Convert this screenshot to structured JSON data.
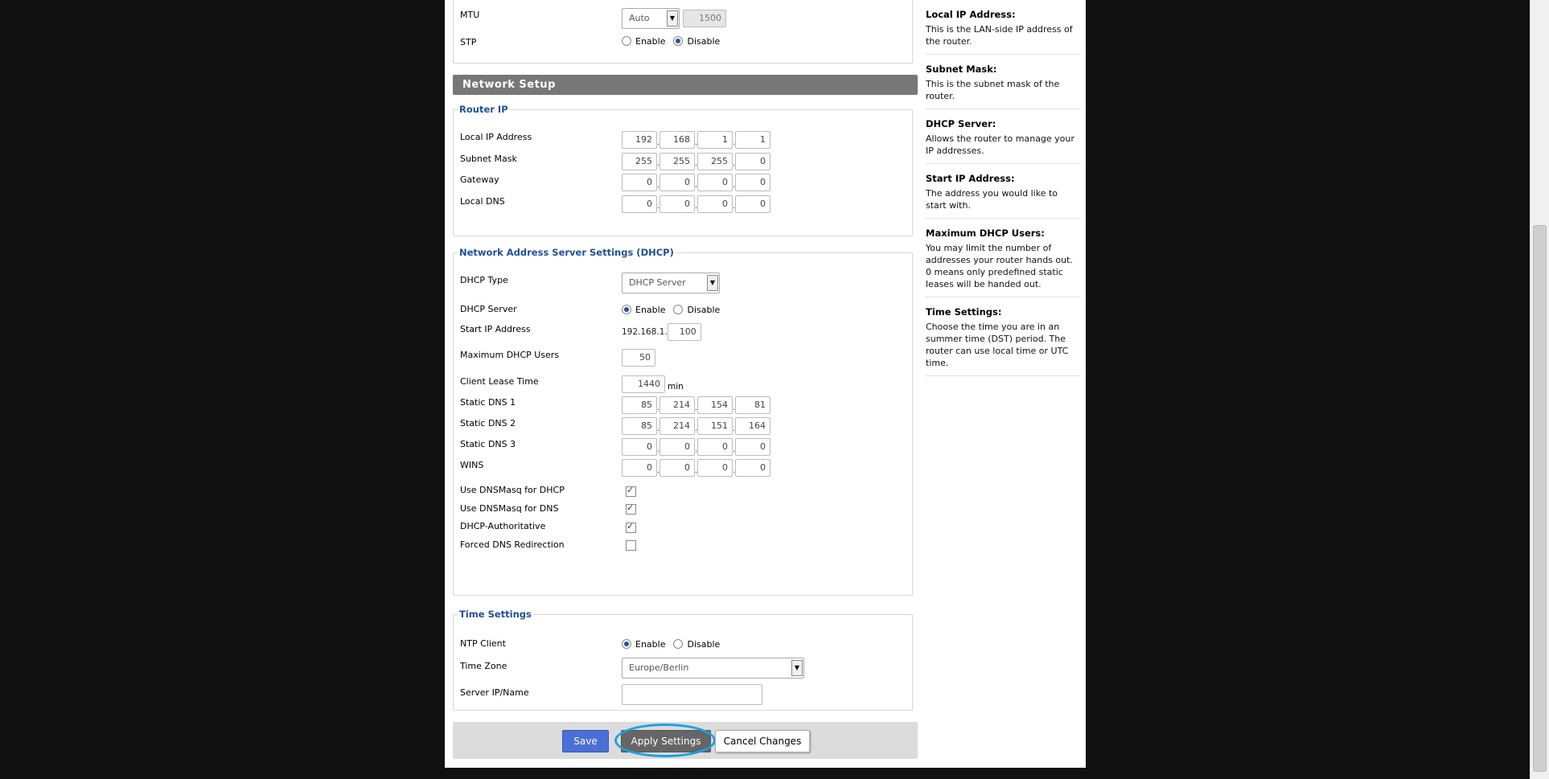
{
  "top": {
    "mtu": {
      "label": "MTU",
      "mode": "Auto",
      "value": "1500"
    },
    "stp": {
      "label": "STP",
      "options": [
        "Enable",
        "Disable"
      ],
      "selected": "Disable"
    }
  },
  "network_setup": {
    "title": "Network Setup",
    "router_ip": {
      "legend": "Router IP",
      "rows": [
        {
          "label": "Local IP Address",
          "octets": [
            "192",
            "168",
            "1",
            "1"
          ]
        },
        {
          "label": "Subnet Mask",
          "octets": [
            "255",
            "255",
            "255",
            "0"
          ]
        },
        {
          "label": "Gateway",
          "octets": [
            "0",
            "0",
            "0",
            "0"
          ]
        },
        {
          "label": "Local DNS",
          "octets": [
            "0",
            "0",
            "0",
            "0"
          ]
        }
      ]
    },
    "dhcp": {
      "legend": "Network Address Server Settings (DHCP)",
      "dhcp_type": {
        "label": "DHCP Type",
        "value": "DHCP Server"
      },
      "dhcp_server": {
        "label": "DHCP Server",
        "options": [
          "Enable",
          "Disable"
        ],
        "selected": "Enable"
      },
      "start_ip": {
        "label": "Start IP Address",
        "prefix": "192.168.1.",
        "value": "100"
      },
      "max_users": {
        "label": "Maximum DHCP Users",
        "value": "50"
      },
      "lease_time": {
        "label": "Client Lease Time",
        "value": "1440",
        "unit": "min"
      },
      "dns_rows": [
        {
          "label": "Static DNS 1",
          "octets": [
            "85",
            "214",
            "154",
            "81"
          ]
        },
        {
          "label": "Static DNS 2",
          "octets": [
            "85",
            "214",
            "151",
            "164"
          ]
        },
        {
          "label": "Static DNS 3",
          "octets": [
            "0",
            "0",
            "0",
            "0"
          ]
        },
        {
          "label": "WINS",
          "octets": [
            "0",
            "0",
            "0",
            "0"
          ]
        }
      ],
      "checks": [
        {
          "label": "Use DNSMasq for DHCP",
          "checked": true
        },
        {
          "label": "Use DNSMasq for DNS",
          "checked": true
        },
        {
          "label": "DHCP-Authoritative",
          "checked": true
        },
        {
          "label": "Forced DNS Redirection",
          "checked": false
        }
      ]
    },
    "time": {
      "legend": "Time Settings",
      "ntp": {
        "label": "NTP Client",
        "options": [
          "Enable",
          "Disable"
        ],
        "selected": "Enable"
      },
      "zone": {
        "label": "Time Zone",
        "value": "Europe/Berlin"
      },
      "server": {
        "label": "Server IP/Name",
        "value": ""
      }
    }
  },
  "buttons": {
    "save": "Save",
    "apply": "Apply Settings",
    "cancel": "Cancel Changes"
  },
  "help": [
    {
      "title": "Local IP Address:",
      "desc": "This is the LAN-side IP address of the router."
    },
    {
      "title": "Subnet Mask:",
      "desc": "This is the subnet mask of the router."
    },
    {
      "title": "DHCP Server:",
      "desc": "Allows the router to manage your IP addresses."
    },
    {
      "title": "Start IP Address:",
      "desc": "The address you would like to start with."
    },
    {
      "title": "Maximum DHCP Users:",
      "desc": "You may limit the number of addresses your router hands out. 0 means only predefined static leases will be handed out."
    },
    {
      "title": "Time Settings:",
      "desc": "Choose the time you are in an summer time (DST) period. The router can use local time or UTC time."
    }
  ],
  "colors": {
    "accent": "#1f4f99",
    "banner": "#777777",
    "save": "#4a6fd6",
    "apply": "#666666",
    "highlight_ring": "#1aa2e6"
  }
}
